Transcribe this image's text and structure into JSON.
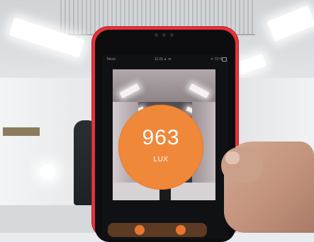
{
  "status_bar": {
    "carrier": "Telcel",
    "time": "11:01 a. m.",
    "right": "✈ 73 %"
  },
  "light_meter": {
    "value": "963",
    "unit": "LUX",
    "accent_color": "#f0883a"
  },
  "bottom_controls": {
    "buttons": [
      {
        "icon": "settings-icon"
      },
      {
        "icon": "shutter-icon"
      }
    ]
  }
}
